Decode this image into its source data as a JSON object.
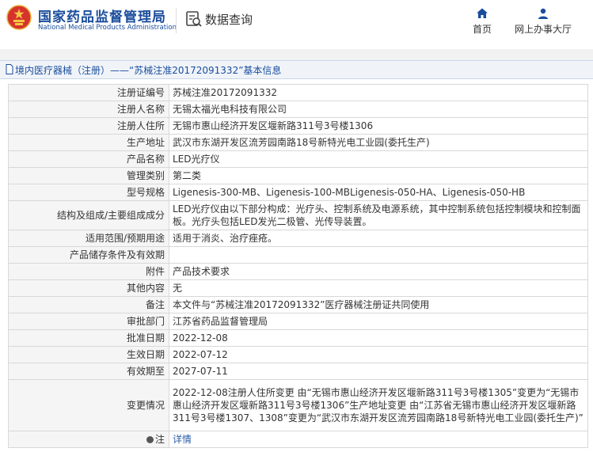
{
  "header": {
    "org_name_cn": "国家药品监督管理局",
    "org_name_en": "National Medical Products Administration",
    "query_label": "数据查询",
    "nav": {
      "home": "首页",
      "online_service": "网上办事大厅"
    }
  },
  "record": {
    "title": "境内医疗器械（注册）——“苏械注准20172091332”基本信息",
    "fields": [
      {
        "label": "注册证编号",
        "value": "苏械注准20172091332"
      },
      {
        "label": "注册人名称",
        "value": "无锡太福光电科技有限公司"
      },
      {
        "label": "注册人住所",
        "value": "无锡市惠山经济开发区堰新路311号3号楼1306"
      },
      {
        "label": "生产地址",
        "value": "武汉市东湖开发区流芳园南路18号新特光电工业园(委托生产)"
      },
      {
        "label": "产品名称",
        "value": "LED光疗仪"
      },
      {
        "label": "管理类别",
        "value": "第二类"
      },
      {
        "label": "型号规格",
        "value": "Ligenesis-300-MB、Ligenesis-100-MBLigenesis-050-HA、Ligenesis-050-HB"
      },
      {
        "label": "结构及组成/主要组成成分",
        "value": "LED光疗仪由以下部分构成：光疗头、控制系统及电源系统，其中控制系统包括控制模块和控制面板。光疗头包括LED发光二极管、光传导装置。"
      },
      {
        "label": "适用范围/预期用途",
        "value": "适用于消炎、治疗痤疮。"
      },
      {
        "label": "产品储存条件及有效期",
        "value": ""
      },
      {
        "label": "附件",
        "value": "产品技术要求"
      },
      {
        "label": "其他内容",
        "value": "无"
      },
      {
        "label": "备注",
        "value": "本文件与“苏械注准20172091332”医疗器械注册证共同使用"
      },
      {
        "label": "审批部门",
        "value": "江苏省药品监督管理局"
      },
      {
        "label": "批准日期",
        "value": "2022-12-08"
      },
      {
        "label": "生效日期",
        "value": "2022-07-12"
      },
      {
        "label": "有效期至",
        "value": "2027-07-11"
      },
      {
        "label": "变更情况",
        "value": "2022-12-08注册人住所变更 由“无锡市惠山经济开发区堰新路311号3号楼1305”变更为“无锡市惠山经济开发区堰新路311号3号楼1306”生产地址变更 由“江苏省无锡市惠山经济开发区堰新路311号3号楼1307、1308”变更为“武汉市东湖开发区流芳园南路18号新特光电工业园(委托生产)”"
      }
    ],
    "note": {
      "label": "注",
      "link": "详情"
    }
  },
  "colors": {
    "brand": "#1a4d9c",
    "label_bg": "#f5f5f5",
    "border": "#d8d8d8"
  },
  "icons": [
    "national-emblem-icon",
    "data-query-icon",
    "home-icon",
    "user-icon",
    "document-icon",
    "info-icon"
  ]
}
